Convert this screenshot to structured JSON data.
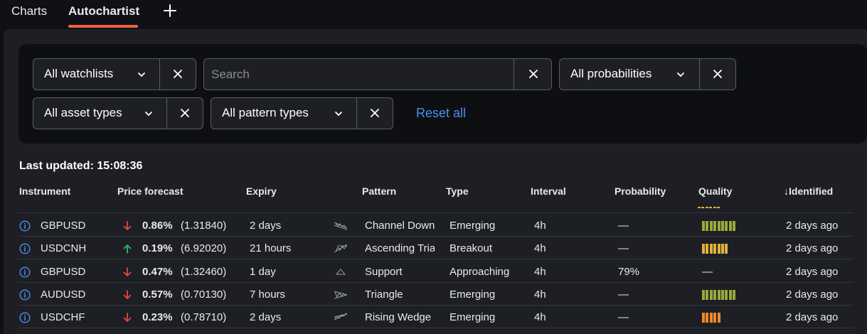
{
  "tabs": [
    {
      "label": "Charts",
      "active": false
    },
    {
      "label": "Autochartist",
      "active": true
    }
  ],
  "filters": {
    "watchlists": "All watchlists",
    "search_placeholder": "Search",
    "probabilities": "All probabilities",
    "asset_types": "All asset types",
    "pattern_types": "All pattern types",
    "reset_label": "Reset all"
  },
  "last_updated": "Last updated: 15:08:36",
  "columns": [
    "Instrument",
    "Price forecast",
    "Expiry",
    "Pattern",
    "Type",
    "Interval",
    "Probability",
    "Quality",
    "↓Identified"
  ],
  "rows": [
    {
      "instrument": "GBPUSD",
      "direction": "down",
      "pct": "0.86%",
      "price": "(1.31840)",
      "expiry": "2 days",
      "pattern_icon": "channel-down-icon",
      "pattern": "Channel Down",
      "type": "Emerging",
      "interval": "4h",
      "probability": "—",
      "quality_level": 9,
      "quality_color": "#9aa83a",
      "quality_text": "",
      "identified": "2 days ago"
    },
    {
      "instrument": "USDCNH",
      "direction": "up",
      "pct": "0.19%",
      "price": "(6.92020)",
      "expiry": "21 hours",
      "pattern_icon": "ascending-triangle-icon",
      "pattern": "Ascending Triangle",
      "type": "Breakout",
      "interval": "4h",
      "probability": "—",
      "quality_level": 7,
      "quality_color": "#e0b23a",
      "quality_text": "",
      "identified": "2 days ago"
    },
    {
      "instrument": "GBPUSD",
      "direction": "down",
      "pct": "0.47%",
      "price": "(1.32460)",
      "expiry": "1 day",
      "pattern_icon": "support-icon",
      "pattern": "Support",
      "type": "Approaching",
      "interval": "4h",
      "probability": "79%",
      "quality_level": 0,
      "quality_color": "#888888",
      "quality_text": "—",
      "identified": "2 days ago"
    },
    {
      "instrument": "AUDUSD",
      "direction": "down",
      "pct": "0.57%",
      "price": "(0.70130)",
      "expiry": "7 hours",
      "pattern_icon": "triangle-icon",
      "pattern": "Triangle",
      "type": "Emerging",
      "interval": "4h",
      "probability": "—",
      "quality_level": 9,
      "quality_color": "#9aa83a",
      "quality_text": "",
      "identified": "2 days ago"
    },
    {
      "instrument": "USDCHF",
      "direction": "down",
      "pct": "0.23%",
      "price": "(0.78710)",
      "expiry": "2 days",
      "pattern_icon": "rising-wedge-icon",
      "pattern": "Rising Wedge",
      "type": "Emerging",
      "interval": "4h",
      "probability": "—",
      "quality_level": 5,
      "quality_color": "#f08a2a",
      "quality_text": "",
      "identified": "2 days ago"
    }
  ],
  "colors": {
    "accent": "#f0643c",
    "link": "#4a90e8",
    "down": "#e8463c",
    "up": "#2eb872"
  }
}
